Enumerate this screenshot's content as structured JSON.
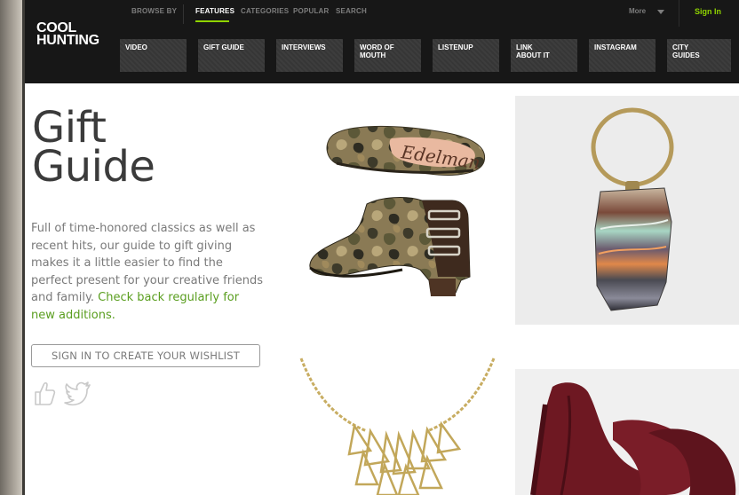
{
  "brand": {
    "line1": "COOL",
    "line2": "HUNTING"
  },
  "topnav": {
    "items": [
      "BROWSE BY",
      "FEATURES",
      "CATEGORIES",
      "POPULAR",
      "SEARCH"
    ],
    "more": "More",
    "sign_in": "Sign In"
  },
  "categories": [
    {
      "line1": "VIDEO",
      "line2": ""
    },
    {
      "line1": "GIFT GUIDE",
      "line2": ""
    },
    {
      "line1": "INTERVIEWS",
      "line2": ""
    },
    {
      "line1": "WORD OF",
      "line2": "MOUTH"
    },
    {
      "line1": "LISTENUP",
      "line2": ""
    },
    {
      "line1": "LINK",
      "line2": "ABOUT IT"
    },
    {
      "line1": "INSTAGRAM",
      "line2": ""
    },
    {
      "line1": "CITY",
      "line2": "GUIDES"
    }
  ],
  "page": {
    "title_line1": "Gift",
    "title_line2": "Guide",
    "intro": "Full of time-honored classics as well as recent hits, our guide to gift giving makes it a little easier to find the perfect present for your creative friends and family.",
    "intro_cta": "Check back regularly for new additions.",
    "wishlist_button": "SIGN IN TO CREATE YOUR WISHLIST"
  },
  "products": {
    "shoe_insole_text": "Edelman"
  },
  "colors": {
    "header_bg": "#171717",
    "accent_green": "#8fd400",
    "cta_green": "#5a9e1f",
    "tile_bg": "#3a3a3a"
  },
  "icons": [
    "like-icon",
    "twitter-icon",
    "chevron-down-icon"
  ]
}
